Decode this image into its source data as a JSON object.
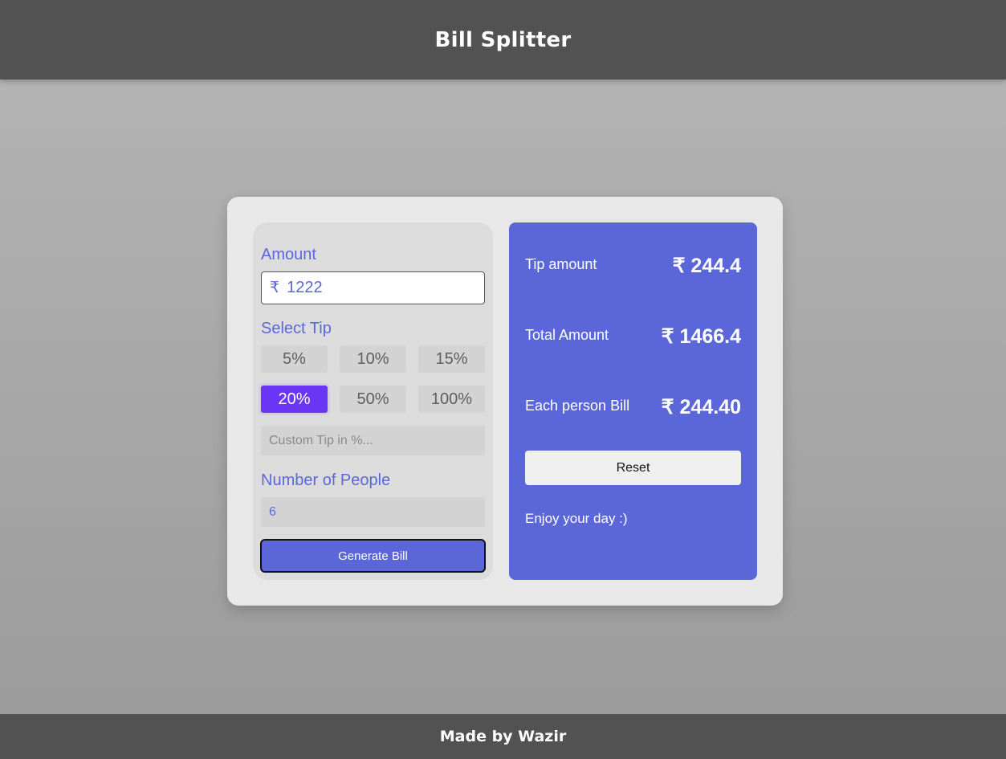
{
  "header": {
    "title": "Bill Splitter"
  },
  "footer": {
    "text": "Made by Wazir"
  },
  "form": {
    "amount_label": "Amount",
    "currency_symbol": "₹",
    "amount_value": "1222",
    "tip_label": "Select Tip",
    "tips": [
      "5%",
      "10%",
      "15%",
      "20%",
      "50%",
      "100%"
    ],
    "selected_tip": "20%",
    "custom_tip_placeholder": "Custom Tip in %...",
    "people_label": "Number of People",
    "people_value": "6",
    "generate_label": "Generate Bill"
  },
  "results": {
    "tip_label": "Tip amount",
    "tip_value": "₹ 244.4",
    "total_label": "Total Amount",
    "total_value": "₹ 1466.4",
    "each_label": "Each person Bill",
    "each_value": "₹ 244.40",
    "reset_label": "Reset",
    "message": "Enjoy your day :)"
  },
  "colors": {
    "accent": "#5b67d9",
    "selected_tip": "#6b35f5",
    "header_bg": "#525252"
  }
}
